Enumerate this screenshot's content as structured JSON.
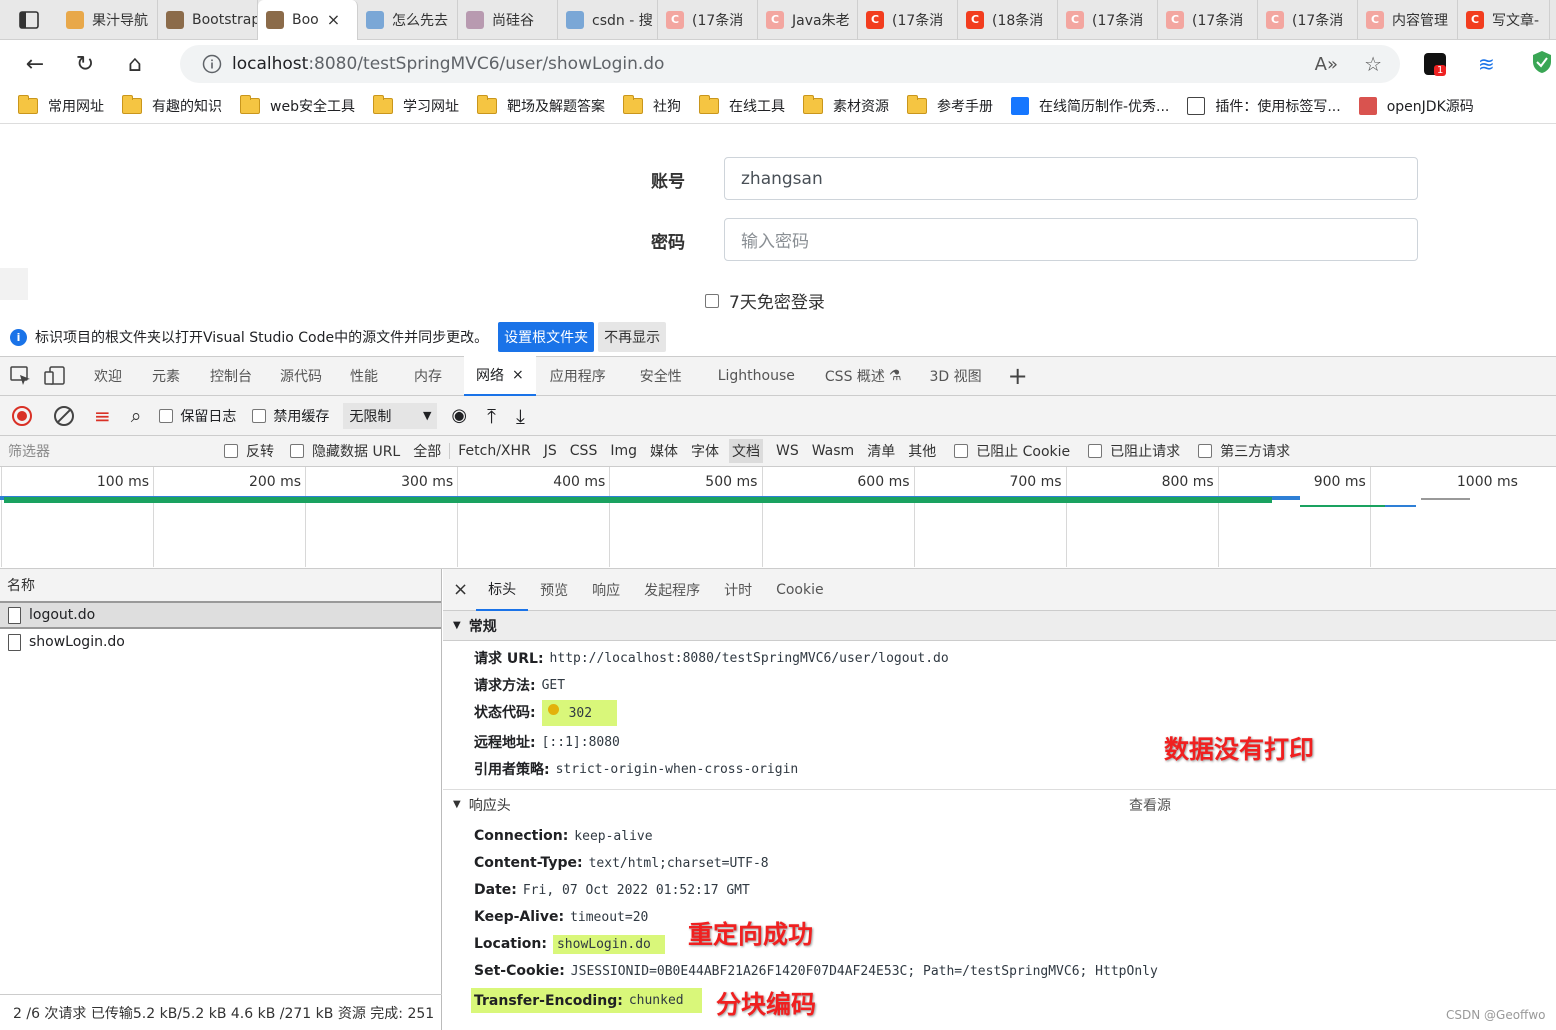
{
  "browser": {
    "tabs": [
      {
        "label": "果汁导航",
        "color": "#e8a84a",
        "glyph": ""
      },
      {
        "label": "Bootstrap",
        "color": "#8b6b4a",
        "glyph": ""
      },
      {
        "label": "Boo",
        "color": "#8b6b4a",
        "glyph": "",
        "active": true
      },
      {
        "label": "怎么先去",
        "color": "#7aa7d6",
        "glyph": ""
      },
      {
        "label": "尚硅谷",
        "color": "#b89ab0",
        "glyph": ""
      },
      {
        "label": "csdn - 搜",
        "color": "#7aa7d6",
        "glyph": ""
      },
      {
        "label": "(17条消",
        "color": "#f3a6a0",
        "glyph": "C"
      },
      {
        "label": "Java朱老",
        "color": "#f3a6a0",
        "glyph": "C"
      },
      {
        "label": "(17条消",
        "color": "#f23d1f",
        "glyph": "C"
      },
      {
        "label": "(18条消",
        "color": "#f23d1f",
        "glyph": "C"
      },
      {
        "label": "(17条消",
        "color": "#f3a6a0",
        "glyph": "C"
      },
      {
        "label": "(17条消",
        "color": "#f3a6a0",
        "glyph": "C"
      },
      {
        "label": "(17条消",
        "color": "#f3a6a0",
        "glyph": "C"
      },
      {
        "label": "内容管理",
        "color": "#f3a6a0",
        "glyph": "C"
      },
      {
        "label": "写文章-",
        "color": "#f23d1f",
        "glyph": "C"
      }
    ],
    "url_host": "localhost",
    "url_rest": ":8080/testSpringMVC6/user/showLogin.do",
    "bookmarks": [
      "常用网址",
      "有趣的知识",
      "web安全工具",
      "学习网址",
      "靶场及解题答案",
      "社狗",
      "在线工具",
      "素材资源",
      "参考手册"
    ],
    "bookmark_extra": [
      "在线简历制作-优秀...",
      "插件：使用标签写...",
      "openJDK源码"
    ],
    "ext_badge": "1",
    "watermark": "CSDN @Geoffwo"
  },
  "login": {
    "account_label": "账号",
    "account_value": "zhangsan",
    "password_label": "密码",
    "password_placeholder": "输入密码",
    "remember_label": "7天免密登录"
  },
  "infobar": {
    "message": "标识项目的根文件夹以打开Visual Studio Code中的源文件并同步更改。",
    "primary_button": "设置根文件夹",
    "secondary_button": "不再显示"
  },
  "devtools": {
    "tabs": [
      "欢迎",
      "元素",
      "控制台",
      "源代码",
      "性能",
      "内存",
      "网络",
      "应用程序",
      "安全性",
      "Lighthouse",
      "CSS 概述",
      "3D 视图"
    ],
    "active_tab": "网络",
    "preserve_log": "保留日志",
    "disable_cache": "禁用缓存",
    "throttle": "无限制",
    "filter_placeholder": "筛选器",
    "filter_checks": [
      "反转",
      "隐藏数据 URL"
    ],
    "filter_types": [
      "全部",
      "Fetch/XHR",
      "JS",
      "CSS",
      "Img",
      "媒体",
      "字体",
      "文档",
      "WS",
      "Wasm",
      "清单",
      "其他"
    ],
    "active_type": "文档",
    "filter_checks2": [
      "已阻止 Cookie",
      "已阻止请求",
      "第三方请求"
    ],
    "timeline_ticks": [
      "100 ms",
      "200 ms",
      "300 ms",
      "400 ms",
      "500 ms",
      "600 ms",
      "700 ms",
      "800 ms",
      "900 ms",
      "1000 ms"
    ],
    "name_header": "名称",
    "requests": [
      "logout.do",
      "showLogin.do"
    ],
    "status_text": "2 /6 次请求  已传输5.2 kB/5.2 kB  4.6 kB /271 kB 资源  完成: 251",
    "detail_tabs": [
      "标头",
      "预览",
      "响应",
      "发起程序",
      "计时",
      "Cookie"
    ],
    "general_title": "常规",
    "general": [
      {
        "k": "请求 URL:",
        "v": "http://localhost:8080/testSpringMVC6/user/logout.do"
      },
      {
        "k": "请求方法:",
        "v": "GET"
      },
      {
        "k": "状态代码:",
        "v": "302"
      },
      {
        "k": "远程地址:",
        "v": "[::1]:8080"
      },
      {
        "k": "引用者策略:",
        "v": "strict-origin-when-cross-origin"
      }
    ],
    "response_title": "响应头",
    "view_source": "查看源",
    "response": [
      {
        "k": "Connection:",
        "v": "keep-alive"
      },
      {
        "k": "Content-Type:",
        "v": "text/html;charset=UTF-8"
      },
      {
        "k": "Date:",
        "v": "Fri, 07 Oct 2022 01:52:17 GMT"
      },
      {
        "k": "Keep-Alive:",
        "v": "timeout=20"
      },
      {
        "k": "Location:",
        "v": "showLogin.do"
      },
      {
        "k": "Set-Cookie:",
        "v": "JSESSIONID=0B0E44ABF21A26F1420F07D4AF24E53C; Path=/testSpringMVC6; HttpOnly"
      },
      {
        "k": "Transfer-Encoding:",
        "v": "chunked"
      }
    ]
  },
  "annotations": {
    "no_data": "数据没有打印",
    "redirect_ok": "重定向成功",
    "chunked": "分块编码"
  },
  "colors": {
    "accent": "#1a73e8",
    "highlight": "#d9f77a",
    "annotation": "#f02020"
  }
}
